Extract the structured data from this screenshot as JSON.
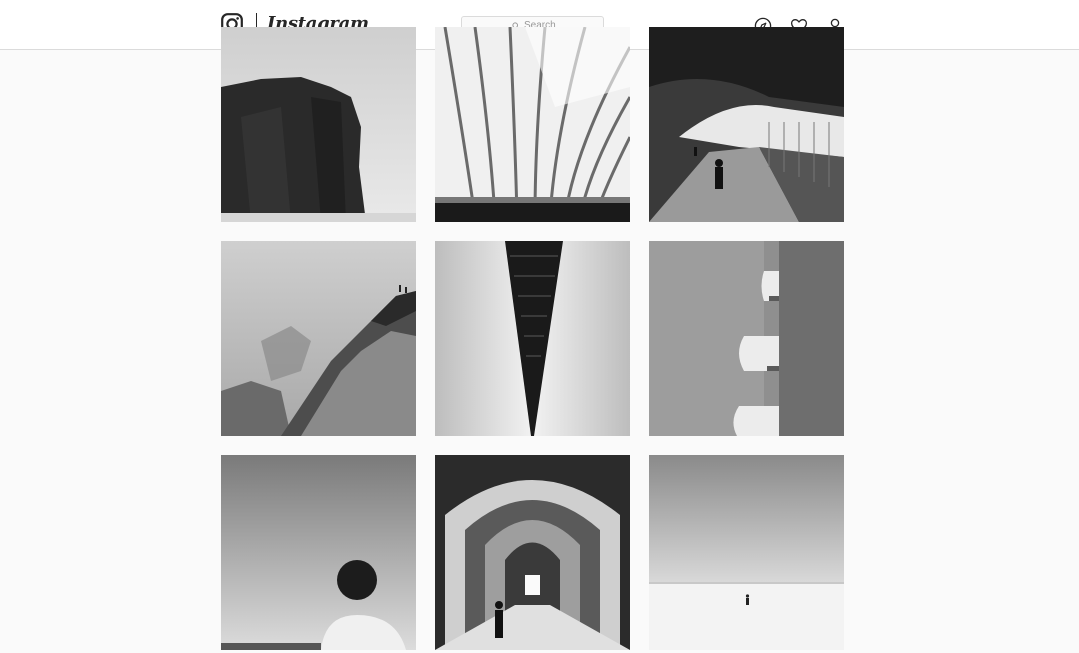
{
  "header": {
    "brand": "Instagram",
    "search": {
      "placeholder": "Search"
    },
    "icons": [
      "instagram-logo-icon",
      "search-icon",
      "explore-compass-icon",
      "heart-icon",
      "profile-icon"
    ]
  },
  "feed": {
    "posts": [
      {
        "subject": "sea-cliff"
      },
      {
        "subject": "curved-roof"
      },
      {
        "subject": "tunnel-walkway"
      },
      {
        "subject": "rocky-coast"
      },
      {
        "subject": "bridge-underside"
      },
      {
        "subject": "building-balconies"
      },
      {
        "subject": "man-silhouette"
      },
      {
        "subject": "arched-corridor"
      },
      {
        "subject": "beach-figure"
      }
    ]
  },
  "colors": {
    "page_background": "#fafafa",
    "header_background": "#ffffff",
    "border": "#dbdbdb",
    "icon": "#262626"
  }
}
